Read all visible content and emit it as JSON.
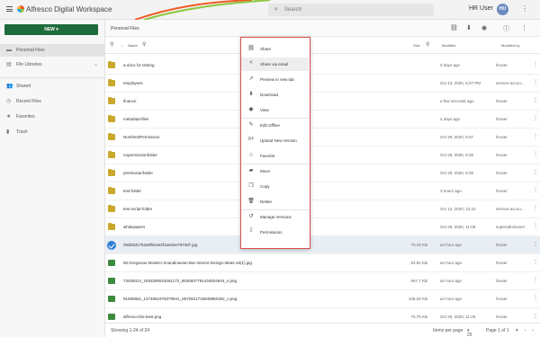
{
  "header": {
    "app_title": "Alfresco Digital Workspace",
    "search_placeholder": "Search",
    "user_name": "HR User",
    "user_initials": "HU"
  },
  "sidebar": {
    "new_label": "NEW",
    "items": [
      {
        "label": "Personal Files",
        "icon": "folder-icon"
      },
      {
        "label": "File Libraries",
        "icon": "library-icon"
      },
      {
        "label": "Shared",
        "icon": "people-icon"
      },
      {
        "label": "Recent Files",
        "icon": "clock-icon"
      },
      {
        "label": "Favorites",
        "icon": "star-icon"
      },
      {
        "label": "Trash",
        "icon": "trash-icon"
      }
    ]
  },
  "content": {
    "breadcrumb": "Personal Files",
    "columns": {
      "name": "Name",
      "size": "Size",
      "modified": "Modified",
      "modified_by": "Modified by"
    },
    "rows": [
      {
        "type": "folder",
        "name": "a-docs for testing",
        "size": "",
        "modified": "3 days ago",
        "by": "hruser"
      },
      {
        "type": "folder",
        "name": "employees",
        "size": "",
        "modified": "Oct 13, 2020, 5:07 PM",
        "by": "service-accou..."
      },
      {
        "type": "folder",
        "name": "finance",
        "size": "",
        "modified": "a few seconds ago",
        "by": "hruser"
      },
      {
        "type": "folder",
        "name": "metadata-files",
        "size": "",
        "modified": "4 days ago",
        "by": "hruser"
      },
      {
        "type": "folder",
        "name": "NoInheritPermission",
        "size": "",
        "modified": "Oct 29, 2020, 8:37",
        "by": "hruser"
      },
      {
        "type": "folder",
        "name": "nopermissionfolder",
        "size": "",
        "modified": "Oct 29, 2020, 8:36",
        "by": "hruser"
      },
      {
        "type": "folder",
        "name": "permissionfolder",
        "size": "",
        "modified": "Oct 29, 2020, 8:30",
        "by": "hruser"
      },
      {
        "type": "folder",
        "name": "test-folder",
        "size": "",
        "modified": "3 hours ago",
        "by": "hruser"
      },
      {
        "type": "folder",
        "name": "test-script-folder",
        "size": "",
        "modified": "Oct 12, 2020, 12:22",
        "by": "service-accou..."
      },
      {
        "type": "folder",
        "name": "whitepapers",
        "size": "",
        "modified": "Oct 29, 2020, 11:08",
        "by": "superadminuser"
      },
      {
        "type": "selected",
        "name": "05d03d1752a0f814e2f1ae63e7973d7.jpg",
        "size": "79.29 KB",
        "modified": "an hour ago",
        "by": "hruser"
      },
      {
        "type": "image",
        "name": "50-Gorgeous-Modern-Scandinavian-Bar-Interior-Design-Ideas-16(1).jpg",
        "size": "83.82 KB",
        "modified": "an hour ago",
        "by": "hruser"
      },
      {
        "type": "image",
        "name": "73409314_2493290524051172_6536507781434834944_n.png",
        "size": "657.7 KB",
        "modified": "an hour ago",
        "by": "hruser"
      },
      {
        "type": "image",
        "name": "91565551_1474651979379941_8570821716949860352_n.png",
        "size": "245.26 KB",
        "modified": "an hour ago",
        "by": "hruser"
      },
      {
        "type": "image",
        "name": "alfresco-the-best.png",
        "size": "76.75 KB",
        "modified": "Oct 29, 2020, 11:25",
        "by": "hruser"
      }
    ],
    "footer": {
      "showing": "Showing 1-24 of 24",
      "items_per_page_label": "Items per page",
      "items_per_page_value": "25",
      "page_info": "Page 1 of 1"
    }
  },
  "context_menu": {
    "items": [
      {
        "label": "Share",
        "icon": "link-icon",
        "glyph": "⛓"
      },
      {
        "label": "Share via email",
        "icon": "share-icon",
        "glyph": "<"
      },
      {
        "label": "Preview in new tab",
        "icon": "open-new-tab-icon",
        "glyph": "↗"
      },
      {
        "label": "Download",
        "icon": "download-icon",
        "glyph": "⬇"
      },
      {
        "label": "View",
        "icon": "eye-icon",
        "glyph": "◉"
      },
      {
        "label": "Edit Offline",
        "icon": "edit-icon",
        "glyph": "✎"
      },
      {
        "label": "Upload New Version",
        "icon": "upload-version-icon",
        "glyph": "≡+"
      },
      {
        "label": "Favorite",
        "icon": "star-outline-icon",
        "glyph": "☆"
      },
      {
        "label": "Move",
        "icon": "move-folder-icon",
        "glyph": "▰"
      },
      {
        "label": "Copy",
        "icon": "copy-icon",
        "glyph": "❐"
      },
      {
        "label": "Delete",
        "icon": "trash-icon",
        "glyph": "🗑"
      },
      {
        "label": "Manage Versions",
        "icon": "history-icon",
        "glyph": "↺"
      },
      {
        "label": "Permissions",
        "icon": "permissions-grid-icon",
        "glyph": "⁞⁞"
      }
    ]
  },
  "colors": {
    "accent": "#1f6b3b",
    "selection": "#2f7fd6",
    "menu_border": "#d9534f"
  }
}
